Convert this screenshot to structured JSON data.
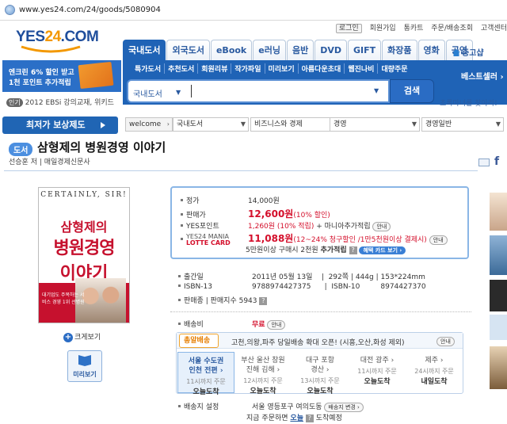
{
  "browser": {
    "url": "www.yes24.com/24/goods/5080904"
  },
  "top_links": [
    "로그인",
    "회원가입",
    "통카트",
    "주문/배송조회",
    "고객센터"
  ],
  "logo": {
    "prefix": "YES",
    "highlight": "24",
    "suffix": ".COM"
  },
  "category_tabs": [
    {
      "label": "국내도서",
      "active": true
    },
    {
      "label": "외국도서",
      "active": false
    },
    {
      "label": "eBook",
      "active": false
    },
    {
      "label": "e러닝",
      "active": false
    },
    {
      "label": "음반",
      "active": false
    },
    {
      "label": "DVD",
      "active": false
    },
    {
      "label": "GIFT",
      "active": false
    },
    {
      "label": "화장품",
      "active": false
    },
    {
      "label": "영화",
      "active": false
    },
    {
      "label": "공연",
      "active": false
    }
  ],
  "used_books": "중고샵",
  "sub_nav": [
    "특가도서",
    "추천도서",
    "회원리뷰",
    "작가파일",
    "미리보기",
    "아름다운초대",
    "웹진나비",
    "대량주문"
  ],
  "best_seller": "베스트셀러 ›",
  "promo": {
    "line1": "엔크린 6% 할인 받고",
    "line2": "1천 포인트 추가적립"
  },
  "hot": {
    "badge": "인기",
    "text": "2012 EBSi 강의교재, 위키드"
  },
  "search": {
    "scope": "국내도서",
    "placeholder": "",
    "button": "검색",
    "extra_link": "초록마녀를 찾아라!"
  },
  "compensation_banner": "최저가 보상제도",
  "breadcrumb": [
    "welcome",
    "국내도서",
    "비즈니스와 경제",
    "경영",
    "경영일반"
  ],
  "book": {
    "category_badge": "도서",
    "title": "삼형제의 병원경영 이야기",
    "author_line": "선승훈 저 | 매일경제신문사"
  },
  "cover": {
    "header": "CERTAINLY, SIR!",
    "line1": "삼형제의",
    "line2": "병원경영",
    "line3": "이야기",
    "small": "대기업도 주목하는 서비스 경영 1위 선병원"
  },
  "cover_actions": {
    "zoom": "크게보기",
    "preview": "미리보기"
  },
  "price": {
    "list_label": "정가",
    "list_value": "14,000원",
    "sale_label": "판매가",
    "sale_value": "12,600원",
    "sale_note": "(10% 할인)",
    "point_label": "YES포인트",
    "point_value": "1,260원 (10% 적립)",
    "point_extra": "+ 마니아추가적립",
    "point_pill": "안내",
    "card_label_top": "YES24 MANIA",
    "card_label_bottom": "LOTTE CARD",
    "card_value": "11,088원",
    "card_note": "(12~24% 청구할인 /1만5천원이상 결제시)",
    "card_pill": "안내",
    "extra_prefix": "5만원이상 구매시 2천원",
    "extra_bold": "추가적립",
    "extra_pill": "혜택 카드 보기 ›"
  },
  "details": {
    "pub_label": "출간일",
    "pub_value": "2011년 05월 13일",
    "pages": "292쪽",
    "weight": "444g",
    "size": "153*224mm",
    "isbn13_label": "ISBN-13",
    "isbn13_value": "9788974427375",
    "isbn10_label": "ISBN-10",
    "isbn10_value": "8974427370",
    "sales_label": "판매종",
    "sales_value": "판매지수 5943"
  },
  "shipping": {
    "fee_label": "배송비",
    "fee_value": "무료",
    "fee_pill": "안내",
    "tag": "총알배송",
    "message": "고천,의왕,파주 당일배송 확대 오픈! (시흥,오산,화성 제외)",
    "more": "안내",
    "regions": [
      {
        "region": "서울 수도권",
        "city": "인천 전편 ›",
        "time": "11시까지 주문",
        "day": "오늘도착",
        "selected": true
      },
      {
        "region": "부산 울산 창원",
        "city": "진해 김해 ›",
        "time": "12시까지 주문",
        "day": "오늘도착",
        "selected": false
      },
      {
        "region": "대구 포항",
        "city": "경산 ›",
        "time": "13시까지 주문",
        "day": "오늘도착",
        "selected": false
      },
      {
        "region": "대전 광주 ›",
        "city": "",
        "time": "11시까지 주문",
        "day": "오늘도착",
        "selected": false
      },
      {
        "region": "제주 ›",
        "city": "",
        "time": "24시까지 주문",
        "day": "내일도착",
        "selected": false
      }
    ],
    "dest_label": "배송지 설정",
    "dest_value": "서울 영등포구 여의도동",
    "dest_pill": "배송지 변경 ›",
    "order_line_prefix": "지금 주문하면",
    "order_line_today": "오늘",
    "order_line_suffix": "도착예정"
  },
  "colors": {
    "brand_blue": "#1f63b6",
    "price_red": "#d40f2b",
    "accent_orange": "#f39800"
  }
}
